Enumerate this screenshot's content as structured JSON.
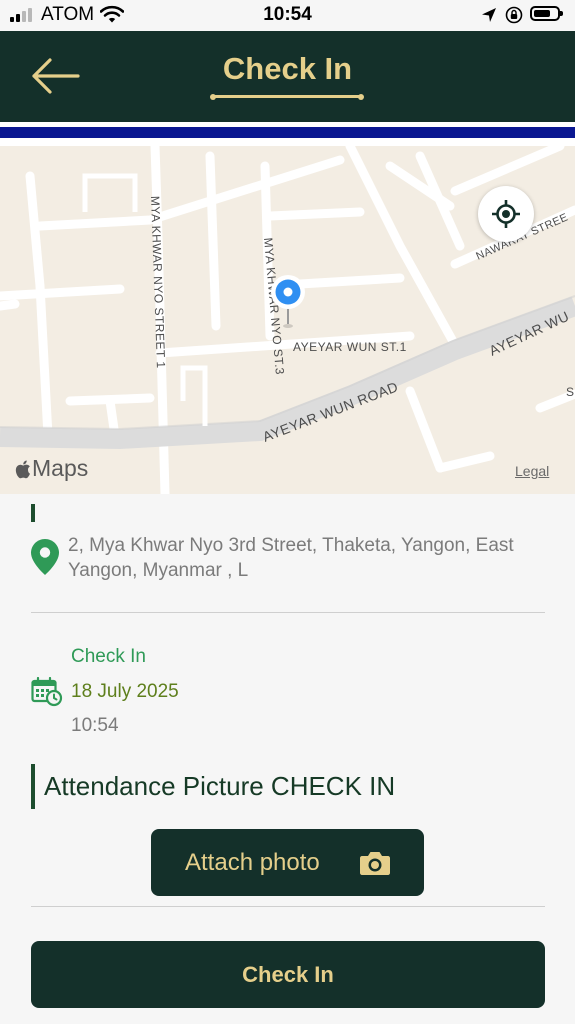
{
  "status_bar": {
    "carrier": "ATOM",
    "time": "10:54",
    "icons": [
      "signal-icon",
      "wifi-icon",
      "location-arrow-icon",
      "orientation-lock-icon",
      "battery-icon"
    ]
  },
  "header": {
    "title": "Check In",
    "back_icon": "arrow-left-icon"
  },
  "map": {
    "streets": [
      "MYA KHWAR NYO STREET 1",
      "MYA KHWAR NYO ST.3",
      "AYEYAR WUN ST.1",
      "AYEYAR WUN ROAD",
      "AYEYAR WU",
      "NAWARAT STREE",
      "S"
    ],
    "attribution": "Maps",
    "legal": "Legal"
  },
  "location": {
    "address": "2, Mya Khwar Nyo 3rd Street, Thaketa, Yangon, East Yangon, Myanmar , L"
  },
  "check_in": {
    "label": "Check In",
    "date": "18 July 2025",
    "time": "10:54"
  },
  "attendance": {
    "title": "Attendance Picture CHECK IN",
    "attach_label": "Attach photo"
  },
  "submit": {
    "label": "Check In"
  },
  "colors": {
    "header_bg": "#14302a",
    "accent_gold": "#e5cf8b",
    "stripe_blue": "#0a1791",
    "checkin_green": "#2f9a57",
    "date_olive": "#5e7f1c"
  }
}
